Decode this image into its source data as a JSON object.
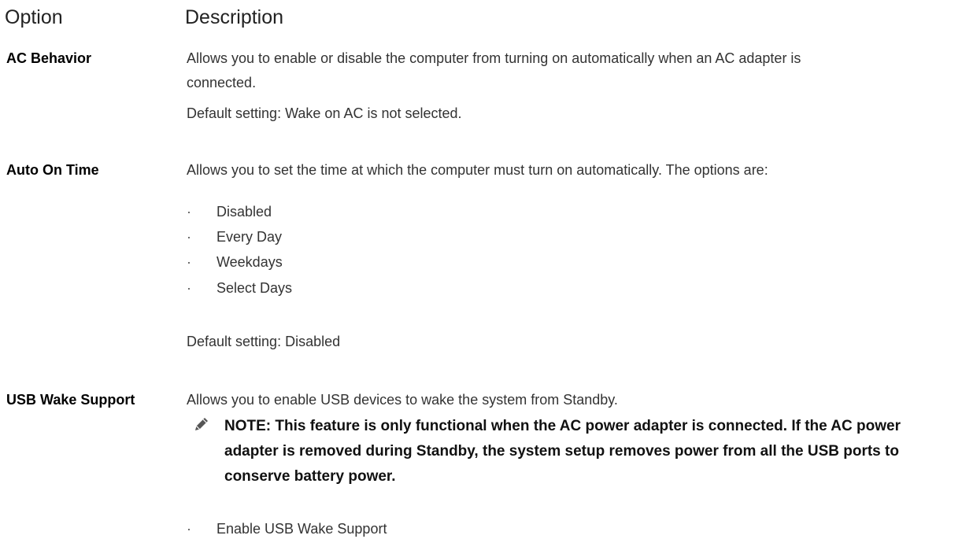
{
  "table": {
    "header": {
      "option": "Option",
      "description": "Description"
    },
    "rows": [
      {
        "option": "AC Behavior",
        "description_lines": [
          "Allows you to enable or disable the computer from turning on automatically when an AC adapter is",
          "connected."
        ],
        "default": "Default setting: Wake on AC is not selected."
      },
      {
        "option": "Auto On Time",
        "description": "Allows you to set the time at which the computer must turn on automatically. The options are:",
        "options": [
          "Disabled",
          "Every Day",
          "Weekdays",
          "Select Days"
        ],
        "default": "Default setting: Disabled"
      },
      {
        "option": "USB Wake Support",
        "description": "Allows you to enable USB devices to wake the system from Standby.",
        "note_icon": "pencil-note-icon",
        "note_lines": [
          "NOTE: This feature is only functional when the AC power adapter is connected. If the AC power",
          "adapter is removed during Standby, the system setup removes power from all the USB ports to",
          "conserve battery power."
        ],
        "options": [
          "Enable USB Wake Support"
        ]
      }
    ]
  }
}
